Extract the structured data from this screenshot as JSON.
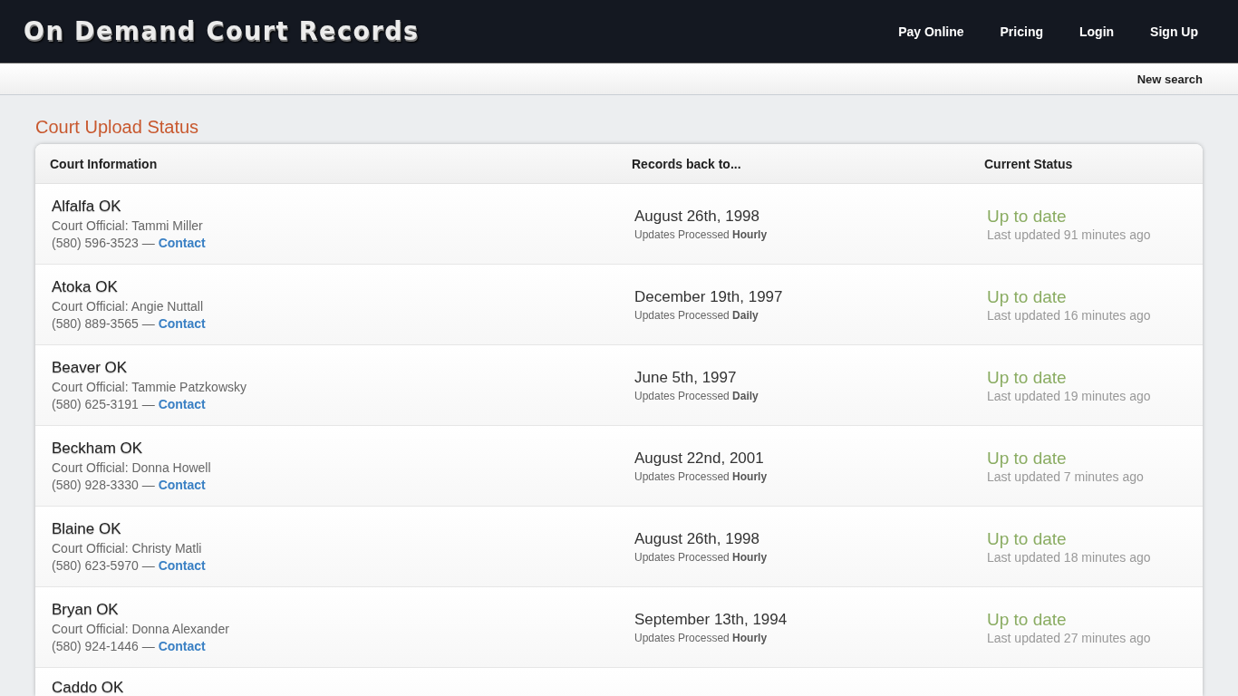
{
  "site": {
    "logo": "On Demand Court Records",
    "nav": [
      "Pay Online",
      "Pricing",
      "Login",
      "Sign Up"
    ],
    "subnav": [
      "New search"
    ]
  },
  "page_title": "Court Upload Status",
  "table": {
    "columns": [
      "Court Information",
      "Records back to...",
      "Current Status"
    ],
    "rows": [
      {
        "name": "Alfalfa OK",
        "official": "Court Official: Tammi Miller",
        "phone": "(580) 596-3523 —",
        "contact": "Contact",
        "date": "August 26th, 1998",
        "frequency": "Updates Processed **Hourly**",
        "status": "Up to date",
        "updated": "Last updated 91 minutes ago"
      },
      {
        "name": "Atoka OK",
        "official": "Court Official: Angie Nuttall",
        "phone": "(580) 889-3565 —",
        "contact": "Contact",
        "date": "December 19th, 1997",
        "frequency": "Updates Processed **Daily**",
        "status": "Up to date",
        "updated": "Last updated 16 minutes ago"
      },
      {
        "name": "Beaver OK",
        "official": "Court Official: Tammie Patzkowsky",
        "phone": "(580) 625-3191 —",
        "contact": "Contact",
        "date": "June 5th, 1997",
        "frequency": "Updates Processed **Daily**",
        "status": "Up to date",
        "updated": "Last updated 19 minutes ago"
      },
      {
        "name": "Beckham OK",
        "official": "Court Official: Donna Howell",
        "phone": "(580) 928-3330 —",
        "contact": "Contact",
        "date": "August 22nd, 2001",
        "frequency": "Updates Processed **Hourly**",
        "status": "Up to date",
        "updated": "Last updated 7 minutes ago"
      },
      {
        "name": "Blaine OK",
        "official": "Court Official: Christy Matli",
        "phone": "(580) 623-5970 —",
        "contact": "Contact",
        "date": "August 26th, 1998",
        "frequency": "Updates Processed **Hourly**",
        "status": "Up to date",
        "updated": "Last updated 18 minutes ago"
      },
      {
        "name": "Bryan OK",
        "official": "Court Official: Donna Alexander",
        "phone": "(580) 924-1446 —",
        "contact": "Contact",
        "date": "September 13th, 1994",
        "frequency": "Updates Processed **Hourly**",
        "status": "Up to date",
        "updated": "Last updated 27 minutes ago"
      },
      {
        "name": "Caddo OK"
      }
    ]
  }
}
